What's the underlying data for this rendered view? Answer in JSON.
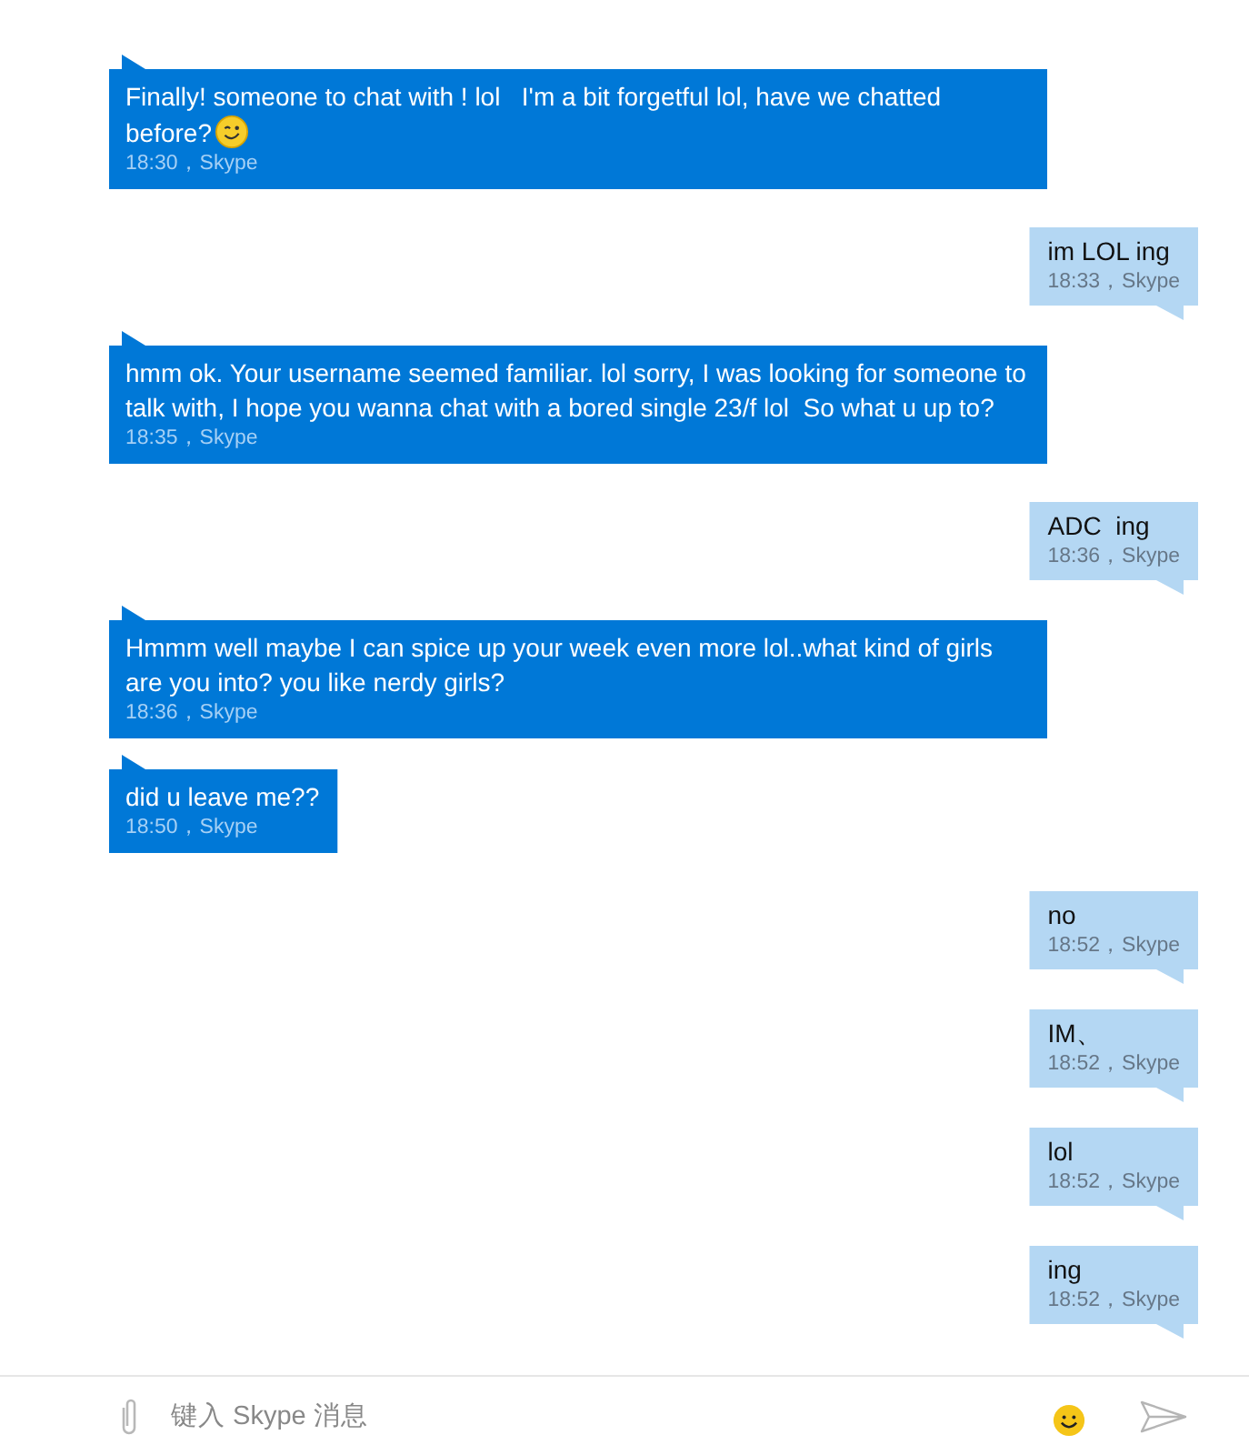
{
  "messages": [
    {
      "kind": "incoming",
      "text": "Finally! someone to chat with ! lol   I'm a bit forgetful lol, have we chatted before?",
      "emoji": true,
      "meta": "18:30，Skype"
    },
    {
      "kind": "outgoing",
      "text": "im LOL ing",
      "meta": "18:33，Skype"
    },
    {
      "kind": "incoming",
      "text": "hmm ok. Your username seemed familiar. lol sorry, I was looking for someone to talk with, I hope you wanna chat with a bored single 23/f lol  So what u up to?",
      "meta": "18:35，Skype"
    },
    {
      "kind": "outgoing",
      "text": "ADC  ing",
      "meta": "18:36，Skype"
    },
    {
      "kind": "incoming",
      "text": "Hmmm well maybe I can spice up your week even more lol..what kind of girls are you into? you like nerdy girls?",
      "meta": "18:36，Skype"
    },
    {
      "kind": "incoming",
      "text": "did u leave me??",
      "meta": "18:50，Skype"
    },
    {
      "kind": "outgoing",
      "text": "no",
      "meta": "18:52，Skype"
    },
    {
      "kind": "outgoing",
      "text": "IM、",
      "meta": "18:52，Skype"
    },
    {
      "kind": "outgoing",
      "text": "lol",
      "meta": "18:52，Skype"
    },
    {
      "kind": "outgoing",
      "text": "ing",
      "meta": "18:52，Skype"
    }
  ],
  "composer": {
    "placeholder": "键入 Skype 消息"
  }
}
